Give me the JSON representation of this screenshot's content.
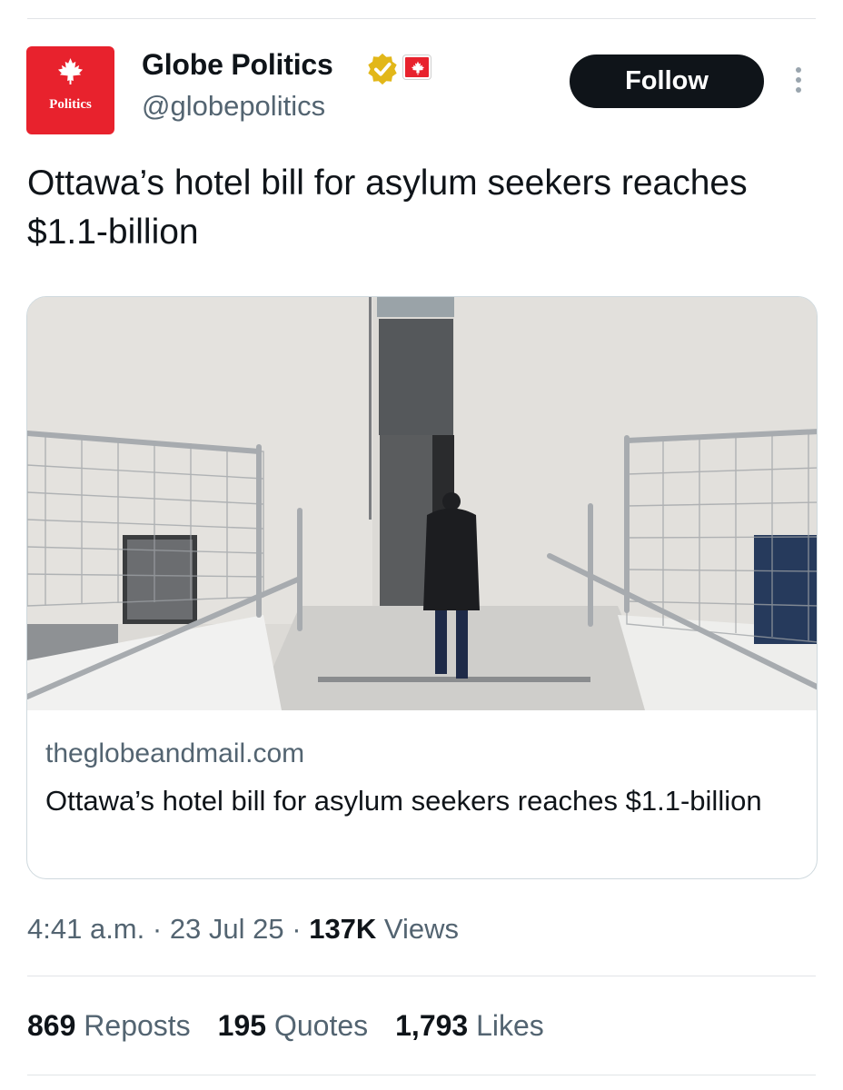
{
  "author": {
    "display_name": "Globe Politics",
    "handle": "@globepolitics",
    "avatar_label": "Politics",
    "avatar_color": "#e8222d",
    "verified_badge_color": "#e2b719"
  },
  "follow_label": "Follow",
  "post": {
    "text": "Ottawa’s hotel bill for asylum seekers reaches $1.1-billion"
  },
  "link_card": {
    "domain": "theglobeandmail.com",
    "title": "Ottawa’s hotel bill for asylum seekers reaches $1.1-billion"
  },
  "meta": {
    "time": "4:41 a.m.",
    "sep1": " · ",
    "date": "23 Jul 25",
    "sep2": " · ",
    "views_count": "137K",
    "views_label": " Views"
  },
  "stats": {
    "reposts_count": "869",
    "reposts_label": " Reposts",
    "quotes_count": "195",
    "quotes_label": " Quotes",
    "likes_count": "1,793",
    "likes_label": " Likes"
  }
}
